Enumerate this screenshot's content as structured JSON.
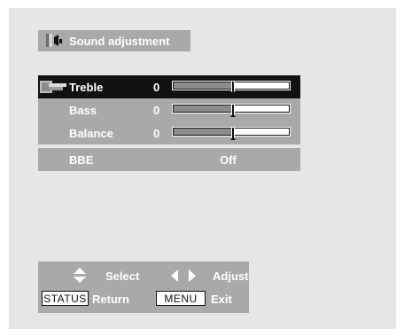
{
  "title": {
    "text": "Sound adjustment",
    "icon": "speaker-icon"
  },
  "menu": {
    "items": [
      {
        "label": "Treble",
        "value": "0",
        "level": 0.5,
        "selected": true
      },
      {
        "label": "Bass",
        "value": "0",
        "level": 0.5,
        "selected": false
      },
      {
        "label": "Balance",
        "value": "0",
        "level": 0.5,
        "selected": false
      },
      {
        "label": "BBE",
        "value": "Off",
        "selected": false
      }
    ]
  },
  "footer": {
    "select_label": "Select",
    "adjust_label": "Adjust",
    "status_key": "STATUS",
    "return_label": "Return",
    "menu_key": "MENU",
    "exit_label": "Exit"
  },
  "colors": {
    "background": "#e6e6e6",
    "panel": "#a9a9a9",
    "selected_row": "#111111",
    "text": "#ffffff"
  }
}
